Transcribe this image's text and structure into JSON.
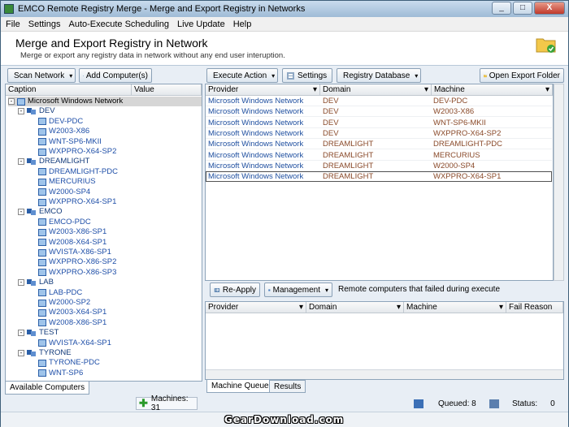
{
  "window": {
    "title": "EMCO Remote Registry Merge - Merge and Export Registry in Networks",
    "min": "_",
    "max": "□",
    "close": "X"
  },
  "menu": [
    "File",
    "Settings",
    "Auto-Execute Scheduling",
    "Live Update",
    "Help"
  ],
  "header": {
    "title": "Merge and Export Registry in Network",
    "subtitle": "Merge or export any registry data in network without any end user interuption."
  },
  "left_toolbar": {
    "scan": "Scan Network",
    "add": "Add Computer(s)"
  },
  "right_toolbar": {
    "execute": "Execute Action",
    "settings": "Settings",
    "registry_db": "Registry Database",
    "open_export": "Open Export Folder"
  },
  "tree": {
    "col_caption": "Caption",
    "col_value": "Value",
    "root": "Microsoft Windows Network",
    "groups": [
      {
        "name": "DEV",
        "machines": [
          "DEV-PDC",
          "W2003-X86",
          "WNT-SP6-MKII",
          "WXPPRO-X64-SP2"
        ]
      },
      {
        "name": "DREAMLIGHT",
        "machines": [
          "DREAMLIGHT-PDC",
          "MERCURIUS",
          "W2000-SP4",
          "WXPPRO-X64-SP1"
        ]
      },
      {
        "name": "EMCO",
        "machines": [
          "EMCO-PDC",
          "W2003-X86-SP1",
          "W2008-X64-SP1",
          "WVISTA-X86-SP1",
          "WXPPRO-X86-SP2",
          "WXPPRO-X86-SP3"
        ]
      },
      {
        "name": "LAB",
        "machines": [
          "LAB-PDC",
          "W2000-SP2",
          "W2003-X64-SP1",
          "W2008-X86-SP1"
        ]
      },
      {
        "name": "TEST",
        "machines": [
          "WVISTA-X64-SP1"
        ]
      },
      {
        "name": "TYRONE",
        "machines": [
          "TYRONE-PDC",
          "WNT-SP6"
        ]
      }
    ]
  },
  "left_tab": "Available Computers",
  "machines_count": "Machines: 31",
  "queue": {
    "cols": [
      "Provider",
      "Domain",
      "Machine"
    ],
    "rows": [
      [
        "Microsoft Windows Network",
        "DEV",
        "DEV-PDC"
      ],
      [
        "Microsoft Windows Network",
        "DEV",
        "W2003-X86"
      ],
      [
        "Microsoft Windows Network",
        "DEV",
        "WNT-SP6-MKII"
      ],
      [
        "Microsoft Windows Network",
        "DEV",
        "WXPPRO-X64-SP2"
      ],
      [
        "Microsoft Windows Network",
        "DREAMLIGHT",
        "DREAMLIGHT-PDC"
      ],
      [
        "Microsoft Windows Network",
        "DREAMLIGHT",
        "MERCURIUS"
      ],
      [
        "Microsoft Windows Network",
        "DREAMLIGHT",
        "W2000-SP4"
      ],
      [
        "Microsoft Windows Network",
        "DREAMLIGHT",
        "WXPPRO-X64-SP1"
      ]
    ]
  },
  "failed": {
    "reapply": "Re-Apply",
    "management": "Management",
    "caption": "Remote computers that failed during execute",
    "cols": [
      "Provider",
      "Domain",
      "Machine",
      "Fail Reason"
    ]
  },
  "bottom_tabs": {
    "queue": "Machine Queue",
    "results": "Results"
  },
  "status": {
    "queued": "Queued: 8",
    "status": "Status:",
    "status_value": "0"
  },
  "watermark": "GearDownload.com"
}
